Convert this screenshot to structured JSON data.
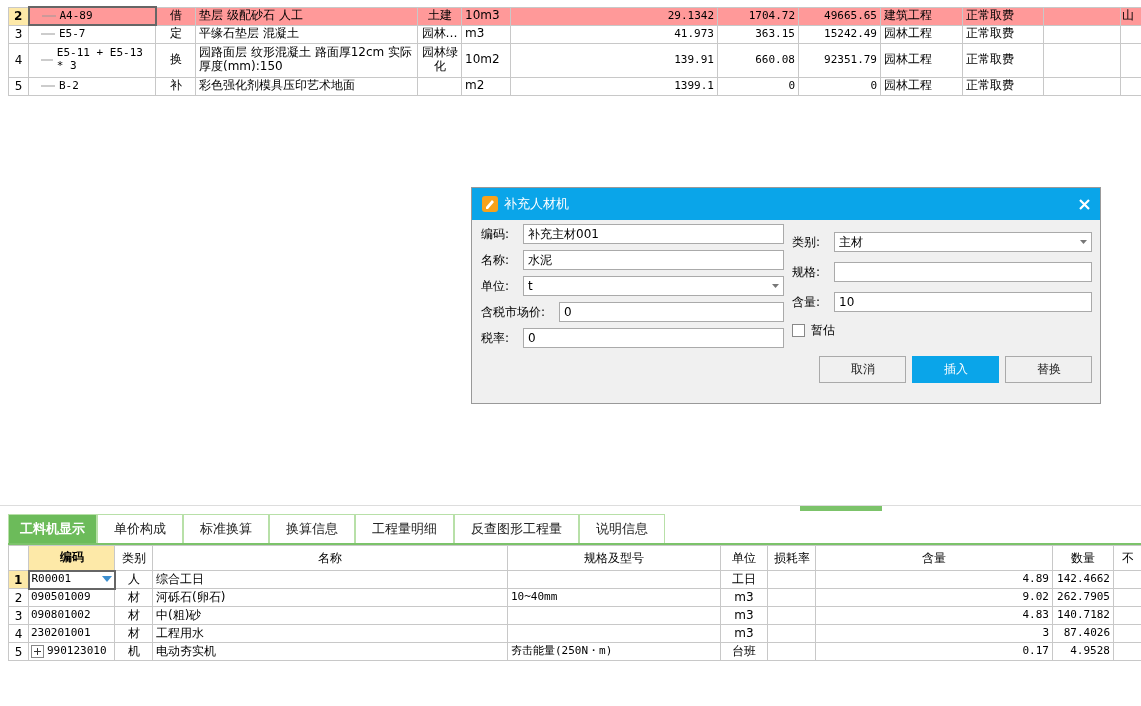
{
  "top_table": {
    "rows": [
      {
        "row_number": "2",
        "code": "A4-89",
        "type": "借",
        "name": "垫层 级配砂石 人工",
        "unit_group": "土建",
        "unit": "10m3",
        "quantity": "29.1342",
        "unit_price": "1704.72",
        "total": "49665.65",
        "category": "建筑工程",
        "fee": "正常取费",
        "column_13": "山",
        "selected": true
      },
      {
        "row_number": "3",
        "code": "E5-7",
        "type": "定",
        "name": "平缘石垫层 混凝土",
        "unit_group": "园林…",
        "unit": "m3",
        "quantity": "41.973",
        "unit_price": "363.15",
        "total": "15242.49",
        "category": "园林工程",
        "fee": "正常取费",
        "selected": false
      },
      {
        "row_number": "4",
        "code": "E5-11 + E5-13 * 3",
        "type": "换",
        "name": "园路面层 纹形混凝土 路面厚12cm  实际厚度(mm):150",
        "unit_group": "园林绿化",
        "unit": "10m2",
        "quantity": "139.91",
        "unit_price": "660.08",
        "total": "92351.79",
        "category": "园林工程",
        "fee": "正常取费",
        "selected": false
      },
      {
        "row_number": "5",
        "code": "B-2",
        "type": "补",
        "name": "彩色强化剂模具压印艺术地面",
        "unit": "m2",
        "quantity": "1399.1",
        "unit_price": "0",
        "total": "0",
        "category": "园林工程",
        "fee": "正常取费",
        "selected": false
      }
    ]
  },
  "dialog": {
    "title": "补充人材机",
    "left_fields": [
      {
        "label": "编码:",
        "kind": "text",
        "value": "补充主材001"
      },
      {
        "label": "名称:",
        "kind": "text",
        "value": "水泥"
      },
      {
        "label": "单位:",
        "kind": "select",
        "value": "t"
      },
      {
        "label": "含税市场价:",
        "kind": "text",
        "value": "0"
      },
      {
        "label": "税率:",
        "kind": "text",
        "value": "0"
      }
    ],
    "right_fields": [
      {
        "label": "类别:",
        "kind": "select",
        "value": "主材"
      },
      {
        "label": "规格:",
        "kind": "text"
      },
      {
        "label": "含量:",
        "kind": "text",
        "value": "10"
      }
    ],
    "checkbox": {
      "label": "暂估",
      "checked": false
    },
    "buttons": [
      {
        "label": "取消",
        "kind": "normal"
      },
      {
        "label": "插入",
        "kind": "primary"
      },
      {
        "label": "替换",
        "kind": "normal"
      }
    ]
  },
  "bottom_tabs": [
    {
      "label": "工料机显示",
      "selected": true
    },
    {
      "label": "单价构成",
      "selected": false
    },
    {
      "label": "标准换算",
      "selected": false
    },
    {
      "label": "换算信息",
      "selected": false
    },
    {
      "label": "工程量明细",
      "selected": false
    },
    {
      "label": "反查图形工程量",
      "selected": false
    },
    {
      "label": "说明信息",
      "selected": false
    }
  ],
  "bottom_table": {
    "columns": [
      {
        "label": "编码",
        "selected": true
      },
      {
        "label": "类别",
        "selected": false
      },
      {
        "label": "名称",
        "selected": false
      },
      {
        "label": "规格及型号",
        "selected": false
      },
      {
        "label": "单位",
        "selected": false
      },
      {
        "label": "损耗率",
        "selected": false
      },
      {
        "label": "含量",
        "selected": false
      },
      {
        "label": "数量",
        "selected": false
      },
      {
        "label": "不",
        "selected": false
      }
    ],
    "rows": [
      {
        "row_number": "1",
        "code": "R00001",
        "type": "人",
        "name": "综合工日",
        "unit": "工日",
        "content": "4.89",
        "amount": "142.4662",
        "selected": true
      },
      {
        "row_number": "2",
        "code": "090501009",
        "type": "材",
        "name": "河砾石(卵石)",
        "spec": "10~40mm",
        "unit": "m3",
        "content": "9.02",
        "amount": "262.7905",
        "selected": false
      },
      {
        "row_number": "3",
        "code": "090801002",
        "type": "材",
        "name": "中(粗)砂",
        "unit": "m3",
        "content": "4.83",
        "amount": "140.7182",
        "selected": false
      },
      {
        "row_number": "4",
        "code": "230201001",
        "type": "材",
        "name": "工程用水",
        "unit": "m3",
        "content": "3",
        "amount": "87.4026",
        "selected": false
      },
      {
        "row_number": "5",
        "code": "990123010",
        "type": "机",
        "name": "电动夯实机",
        "spec": "夯击能量(250N・m)",
        "unit": "台班",
        "content": "0.17",
        "amount": "4.9528",
        "selected": false,
        "expanded": false
      }
    ]
  }
}
